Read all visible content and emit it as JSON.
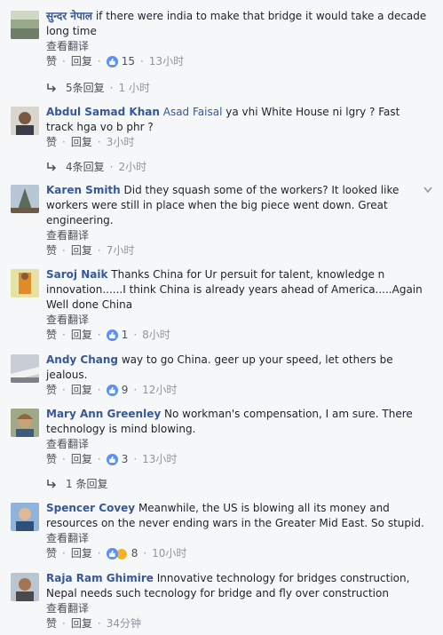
{
  "actions": {
    "like": "赞",
    "reply": "回复",
    "translate": "查看翻译"
  },
  "comments": [
    {
      "author": "सुन्दर नेपाल",
      "text": "if there were india to make that bridge it would take a decade long time",
      "reactions": "15",
      "time": "13小时",
      "replies": "5条回复",
      "replies_time": "1 小时"
    },
    {
      "author": "Abdul Samad Khan",
      "mention": "Asad Faisal",
      "text": "ya vhi White House ni lgry ? Fast track hga vo b phr ?",
      "time": "3小时",
      "replies": "4条回复",
      "replies_time": "2小时"
    },
    {
      "author": "Karen Smith",
      "text": "Did they squash some of the workers? It looked like workers were still in place when the big piece went down. Great engineering.",
      "time": "7小时"
    },
    {
      "author": "Saroj Naik",
      "text": "Thanks China for Ur persuit for talent, knowledge n innovation......I think China is already years ahead of America.....Again Well done China",
      "reactions": "1",
      "time": "8小时"
    },
    {
      "author": "Andy Chang",
      "text": "way to go China. geer up your speed, let others be jealous.",
      "reactions": "9",
      "time": "12小时"
    },
    {
      "author": "Mary Ann Greenley",
      "text": "No workman's compensation, I am sure. There technology is mind blowing.",
      "reactions": "3",
      "time": "13小时",
      "replies": "1 条回复"
    },
    {
      "author": "Spencer Covey",
      "text": "Meanwhile, the US is blowing all its money and resources on the never ending wars in the Greater Mid East. So stupid.",
      "reactions": "8",
      "time": "10小时"
    },
    {
      "author": "Raja Ram Ghimire",
      "text": "Innovative technology for bridges construction, Nepal needs such tecnology for bridge and fly over construction",
      "time": "34分钟"
    }
  ],
  "colors": {
    "link": "#365899",
    "meta": "#90949c",
    "like": "#5890ff",
    "wow": "#f7b125",
    "background": "#f6f7f9"
  }
}
